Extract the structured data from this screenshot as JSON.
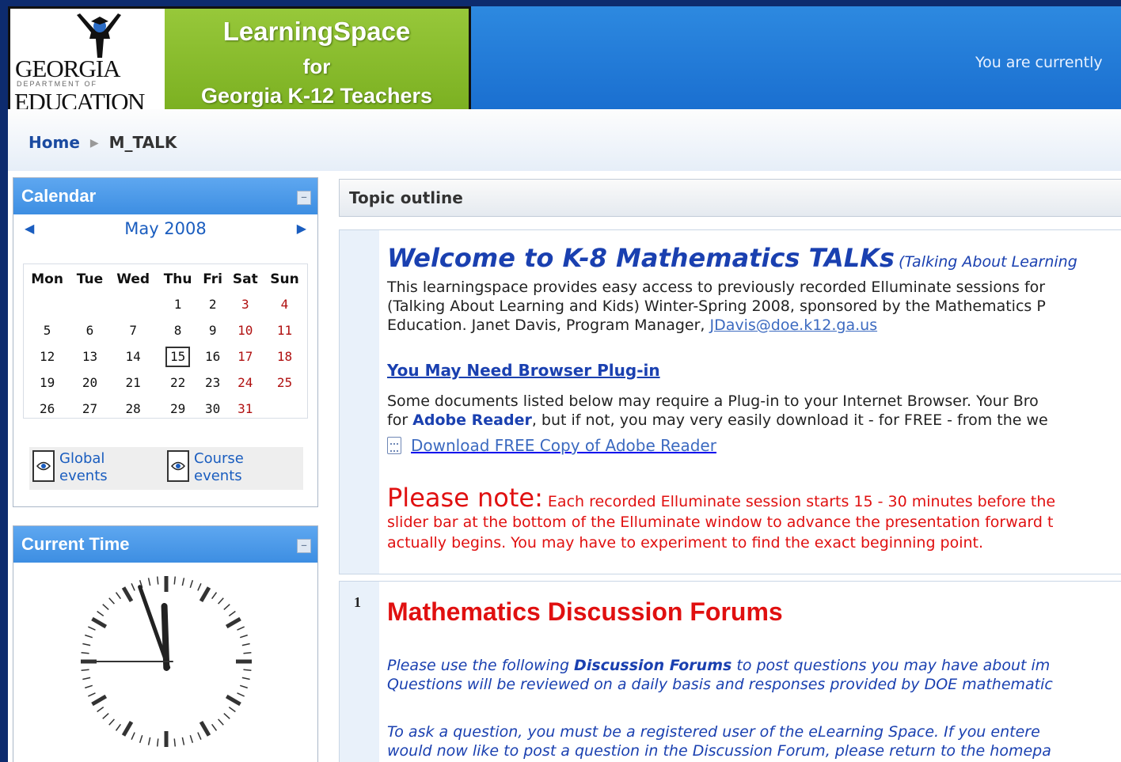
{
  "header": {
    "logo": {
      "georgia": "GEORGIA",
      "department": "DEPARTMENT OF",
      "education": "EDUCATION",
      "line1": "LearningSpace",
      "line2": "for",
      "line3": "Georgia K-12 Teachers"
    },
    "login_info": "You are currently"
  },
  "breadcrumb": {
    "home": "Home",
    "separator": "▶",
    "current": "M_TALK"
  },
  "calendar": {
    "title": "Calendar",
    "hide_icon": "minus-icon",
    "prev_icon": "◀",
    "next_icon": "▶",
    "month": "May 2008",
    "weekdays": [
      "Mon",
      "Tue",
      "Wed",
      "Thu",
      "Fri",
      "Sat",
      "Sun"
    ],
    "weeks": [
      [
        "",
        "",
        "",
        "1",
        "2",
        "3",
        "4"
      ],
      [
        "5",
        "6",
        "7",
        "8",
        "9",
        "10",
        "11"
      ],
      [
        "12",
        "13",
        "14",
        "15",
        "16",
        "17",
        "18"
      ],
      [
        "19",
        "20",
        "21",
        "22",
        "23",
        "24",
        "25"
      ],
      [
        "26",
        "27",
        "28",
        "29",
        "30",
        "31",
        ""
      ]
    ],
    "today": "15",
    "events": [
      {
        "icon": "eye-icon",
        "line1": "Global",
        "line2": "events"
      },
      {
        "icon": "eye-icon",
        "line1": "Course",
        "line2": "events"
      }
    ]
  },
  "current_time": {
    "title": "Current Time",
    "hide_icon": "minus-icon",
    "clock": {
      "hour": 11,
      "minute": 56,
      "second": 45
    }
  },
  "main": {
    "header_title": "Topic outline",
    "welcome": {
      "title": "Welcome to K-8 Mathematics TALKs",
      "subtitle": "(Talking About Learning",
      "para1": [
        "This learningspace provides easy access to previously recorded Elluminate sessions for",
        "(Talking About Learning and Kids) Winter-Spring 2008, sponsored by the Mathematics P",
        "Education.  Janet Davis, Program Manager, "
      ],
      "email": "JDavis@doe.k12.ga.us",
      "plugin_title": "You May Need Browser Plug-in",
      "plugin_line1": "Some documents listed below may require a Plug-in to your Internet Browser. Your Bro",
      "plugin_line2_pre": "for ",
      "plugin_line2_bold": "Adobe Reader",
      "plugin_line2_post": ", but if not, you may very easily download it - for FREE - from the we",
      "download_label": "Download FREE Copy of Adobe Reader",
      "note_label": "Please note:",
      "note_line1": " Each recorded Elluminate session starts 15 - 30 minutes before the",
      "note_line2": "slider bar at the bottom of the Elluminate window to advance the presentation forward t",
      "note_line3": "actually begins. You may have to experiment to find the exact beginning point."
    },
    "section1": {
      "number": "1",
      "title": "Mathematics Discussion Forums",
      "line1_pre": "Please use the following ",
      "line1_bold": "Discussion Forums",
      "line1_post": " to post questions you may have about im",
      "line2": "Questions will be reviewed on a daily basis and responses provided by DOE mathematic",
      "line3": "To ask a question, you must be a registered user of the eLearning Space. If you entere",
      "line4": "would now like to post a question in the Discussion Forum, please return to the homepa"
    }
  }
}
